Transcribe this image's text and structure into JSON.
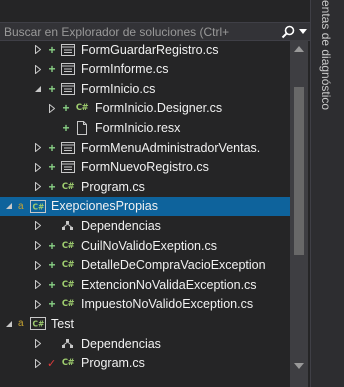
{
  "search": {
    "placeholder": "Buscar en Explorador de soluciones (Ctrl+"
  },
  "side_tab": {
    "label": "entas de diagnóstico"
  },
  "tree_items": [
    {
      "label": "FormGuardarRegistro.cs",
      "icon": "form-icon",
      "state": "collapsed",
      "mark": "plus"
    },
    {
      "label": "FormInforme.cs",
      "icon": "form-icon",
      "state": "collapsed",
      "mark": "plus"
    },
    {
      "label": "FormInicio.cs",
      "icon": "form-icon",
      "state": "expanded",
      "mark": "plus"
    },
    {
      "label": "FormInicio.Designer.cs",
      "icon": "csharp-icon",
      "state": "collapsed",
      "mark": "plus"
    },
    {
      "label": "FormInicio.resx",
      "icon": "resx-file-icon",
      "state": "none",
      "mark": "plus"
    },
    {
      "label": "FormMenuAdministradorVentas.",
      "icon": "form-icon",
      "state": "collapsed",
      "mark": "plus"
    },
    {
      "label": "FormNuevoRegistro.cs",
      "icon": "form-icon",
      "state": "collapsed",
      "mark": "plus"
    },
    {
      "label": "Program.cs",
      "icon": "csharp-icon",
      "state": "collapsed",
      "mark": "plus"
    },
    {
      "label": "ExepcionesPropias",
      "icon": "csharp-project-icon",
      "state": "expanded",
      "mark": "lock"
    },
    {
      "label": "Dependencias",
      "icon": "dependencies-icon",
      "state": "collapsed",
      "mark": "none"
    },
    {
      "label": "CuilNoValidoExeption.cs",
      "icon": "csharp-icon",
      "state": "collapsed",
      "mark": "plus"
    },
    {
      "label": "DetalleDeCompraVacioException",
      "icon": "csharp-icon",
      "state": "collapsed",
      "mark": "plus"
    },
    {
      "label": "ExtencionNoValidaException.cs",
      "icon": "csharp-icon",
      "state": "collapsed",
      "mark": "plus"
    },
    {
      "label": "ImpuestoNoValidoException.cs",
      "icon": "csharp-icon",
      "state": "collapsed",
      "mark": "plus"
    },
    {
      "label": "Test",
      "icon": "csharp-project-icon",
      "state": "expanded",
      "mark": "lock"
    },
    {
      "label": "Dependencias",
      "icon": "dependencies-icon",
      "state": "collapsed",
      "mark": "none"
    },
    {
      "label": "Program.cs",
      "icon": "csharp-icon",
      "state": "collapsed",
      "mark": "check"
    }
  ],
  "selected_item": "ExepcionesPropias",
  "colors": {
    "background": "#252526",
    "selection": "#0e639c",
    "text": "#f1f1f1",
    "added_mark": "#89d185",
    "csharp": "#9fce6f",
    "lock": "#c5a332"
  }
}
